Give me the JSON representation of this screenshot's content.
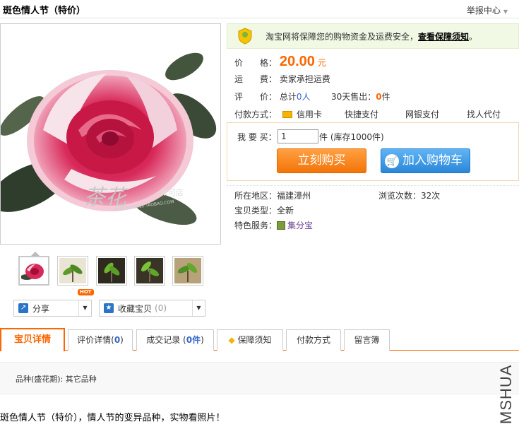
{
  "header": {
    "title": "斑色情人节（特价）",
    "report_label": "举报中心"
  },
  "main_image": {
    "watermark_text": "茶花",
    "watermark_suffix": "米可店",
    "watermark_url": "SHOP3449911.TAOBAO.COM"
  },
  "thumbnails": [
    {
      "name": "thumb-1",
      "kind": "red-camellia"
    },
    {
      "name": "thumb-2",
      "kind": "green-seedling"
    },
    {
      "name": "thumb-3",
      "kind": "green-seedling"
    },
    {
      "name": "thumb-4",
      "kind": "green-seedling"
    },
    {
      "name": "thumb-5",
      "kind": "green-seedling"
    }
  ],
  "actions": {
    "hot_badge": "HOT",
    "share_label": "分享",
    "favorite_label": "收藏宝贝",
    "favorite_count": "(0)"
  },
  "guarantee": {
    "text": "淘宝网将保障您的购物资金及运费安全，",
    "link": "查看保障须知",
    "end": "。"
  },
  "product": {
    "price_label": "价　　格：",
    "price": "20.00",
    "price_unit": "元",
    "shipping_label": "运　　费：",
    "shipping_value": "卖家承担运费",
    "rating_label": "评　　价：",
    "rating_prefix": "总计",
    "rating_value": "0人",
    "sold_prefix": "30天售出：",
    "sold_value": "0",
    "sold_unit": "件"
  },
  "payment": {
    "label": "付款方式：",
    "methods": [
      "信用卡",
      "快捷支付",
      "网银支付",
      "找人代付"
    ]
  },
  "buy": {
    "qty_label": "我 要 买：",
    "qty_value": "1",
    "stock_text": "件 (库存1000件)",
    "buy_now": "立刻购买",
    "add_cart": "加入购物车"
  },
  "info": {
    "location_label": "所在地区：",
    "location_value": "福建漳州",
    "views_label": "浏览次数：",
    "views_value": "32次",
    "type_label": "宝贝类型：",
    "type_value": "全新",
    "service_label": "特色服务：",
    "service_value": "集分宝"
  },
  "tabs": {
    "details": "宝贝详情",
    "reviews_prefix": "评价详情(",
    "reviews_count": "0",
    "reviews_suffix": ")",
    "records_prefix": "成交记录 (",
    "records_count": "0件",
    "records_suffix": ")",
    "guarantee": "保障须知",
    "payment": "付款方式",
    "guestbook": "留言簿"
  },
  "attributes": {
    "variety": "品种(盛花期): 其它品种"
  },
  "description": "斑色情人节（特价），情人节的变异品种，实物看照片！",
  "side_watermark": "MSHUA",
  "colors": {
    "accent_orange": "#ff6600",
    "link_blue": "#3366cc",
    "guarantee_bg": "#f1f9e5",
    "buy_button": "#f37408",
    "cart_button": "#2a87d8"
  }
}
